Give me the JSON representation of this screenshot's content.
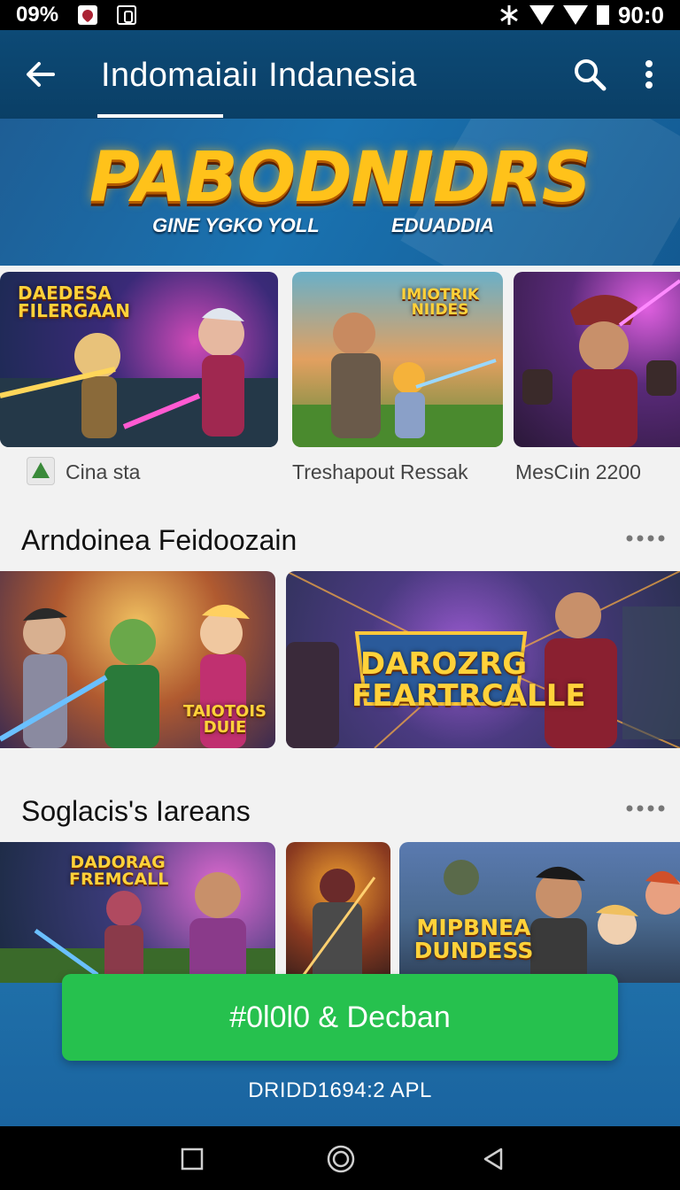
{
  "status_bar": {
    "left_text": "09%",
    "time": "90:0"
  },
  "app_bar": {
    "title": "Indomaiaiı Indanesia"
  },
  "banner": {
    "logo": "PABODNIDRS",
    "sub_left": "GINE YGKO YOLL",
    "sub_right": "EDUADDIA"
  },
  "featured_row": {
    "items": [
      {
        "art_title": "DAEDESA FILERGAAN",
        "label": "Cina sta"
      },
      {
        "art_title": "IMIOTRIK NIIDES",
        "label": "Treshapout Ressak"
      },
      {
        "art_title": "",
        "label": "MesCıin 2200"
      }
    ]
  },
  "section1": {
    "title": "Arndoinea Feidoozain",
    "cards": [
      {
        "art_title": "TAIOTOIS DUIE"
      },
      {
        "art_title": "DAROZRG FEARTRCALLE"
      }
    ]
  },
  "section2": {
    "title": "Soglacis's Iareans",
    "cards": [
      {
        "art_title": "DADORAG FREMCALL"
      },
      {
        "art_title": ""
      },
      {
        "art_title": "MIPBNEA DUNDESS"
      }
    ]
  },
  "install": {
    "button_label": "#0l0l0 & Decban",
    "subtext": "DRIDD1694:2 APL"
  },
  "colors": {
    "app_bar": "#0d4a76",
    "install_button": "#26c14e",
    "install_area": "#1f6fa8"
  }
}
